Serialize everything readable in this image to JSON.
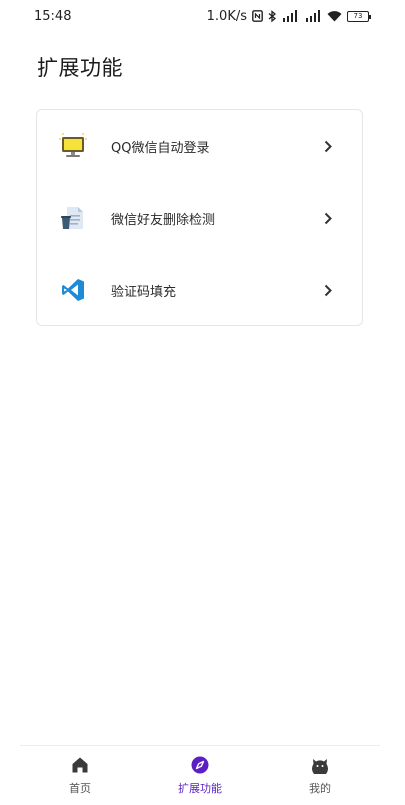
{
  "status_bar": {
    "time": "15:48",
    "speed": "1.0K/s",
    "battery": "73",
    "icons": [
      "nfc-icon",
      "bluetooth-icon",
      "signal-icon",
      "signal-icon",
      "wifi-icon",
      "battery-icon"
    ]
  },
  "page": {
    "title": "扩展功能"
  },
  "features": [
    {
      "label": "QQ微信自动登录",
      "icon": "computer-monitor-icon"
    },
    {
      "label": "微信好友删除检测",
      "icon": "document-trash-icon"
    },
    {
      "label": "验证码填充",
      "icon": "vscode-icon"
    }
  ],
  "bottom_nav": {
    "items": [
      {
        "label": "首页",
        "icon": "home-icon",
        "active": false
      },
      {
        "label": "扩展功能",
        "icon": "compass-icon",
        "active": true
      },
      {
        "label": "我的",
        "icon": "cat-face-icon",
        "active": false
      }
    ],
    "active_color": "#5b1fc4"
  }
}
